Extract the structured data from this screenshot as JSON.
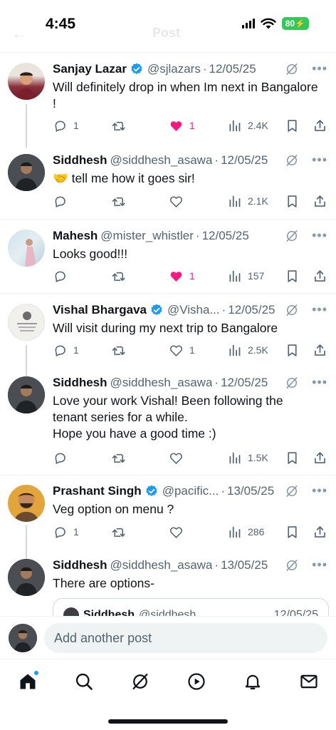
{
  "status_bar": {
    "time": "4:45",
    "battery": "80"
  },
  "header": {
    "title": "Post"
  },
  "posts": [
    {
      "name": "Sanjay Lazar",
      "verified": true,
      "handle": "@sjlazars",
      "date": "12/05/25",
      "text": "Will definitely drop in when Im next in Bangalore !",
      "replies": "1",
      "retweets": "",
      "likes": "1",
      "liked": true,
      "views": "2.4K"
    },
    {
      "name": "Siddhesh",
      "verified": false,
      "handle": "@siddhesh_asawa",
      "date": "12/05/25",
      "text": "🤝 tell me how it goes sir!",
      "replies": "",
      "retweets": "",
      "likes": "",
      "liked": false,
      "views": "2.1K"
    },
    {
      "name": "Mahesh",
      "verified": false,
      "handle": "@mister_whistler",
      "date": "12/05/25",
      "text": "Looks good!!!",
      "replies": "",
      "retweets": "",
      "likes": "1",
      "liked": true,
      "views": "157"
    },
    {
      "name": "Vishal Bhargava",
      "verified": true,
      "handle": "@Visha...",
      "date": "12/05/25",
      "text": "Will visit during my next trip to Bangalore",
      "replies": "1",
      "retweets": "",
      "likes": "1",
      "liked": false,
      "views": "2.5K"
    },
    {
      "name": "Siddhesh",
      "verified": false,
      "handle": "@siddhesh_asawa",
      "date": "12/05/25",
      "text": "Love your work Vishal! Been following the tenant series for a while.",
      "text2": "Hope you have a good time :)",
      "replies": "",
      "retweets": "",
      "likes": "",
      "liked": false,
      "views": "1.5K"
    },
    {
      "name": "Prashant Singh",
      "verified": true,
      "handle": "@pacific...",
      "date": "13/05/25",
      "text": "Veg option on menu ?",
      "replies": "1",
      "retweets": "",
      "likes": "",
      "liked": false,
      "views": "286"
    },
    {
      "name": "Siddhesh",
      "verified": false,
      "handle": "@siddhesh_asawa",
      "date": "13/05/25",
      "text": "There are options-",
      "quote": {
        "name": "Siddhesh",
        "handle": "@siddhesh...",
        "date": "12/05/25"
      }
    }
  ],
  "reply_bar": {
    "placeholder": "Add another post"
  },
  "tabs": [
    "home-icon",
    "search-icon",
    "grok-icon",
    "video-icon",
    "notifications-icon",
    "messages-icon"
  ],
  "colors": {
    "accent": "#1d9bf0",
    "like": "#f91880",
    "muted": "#536471"
  }
}
